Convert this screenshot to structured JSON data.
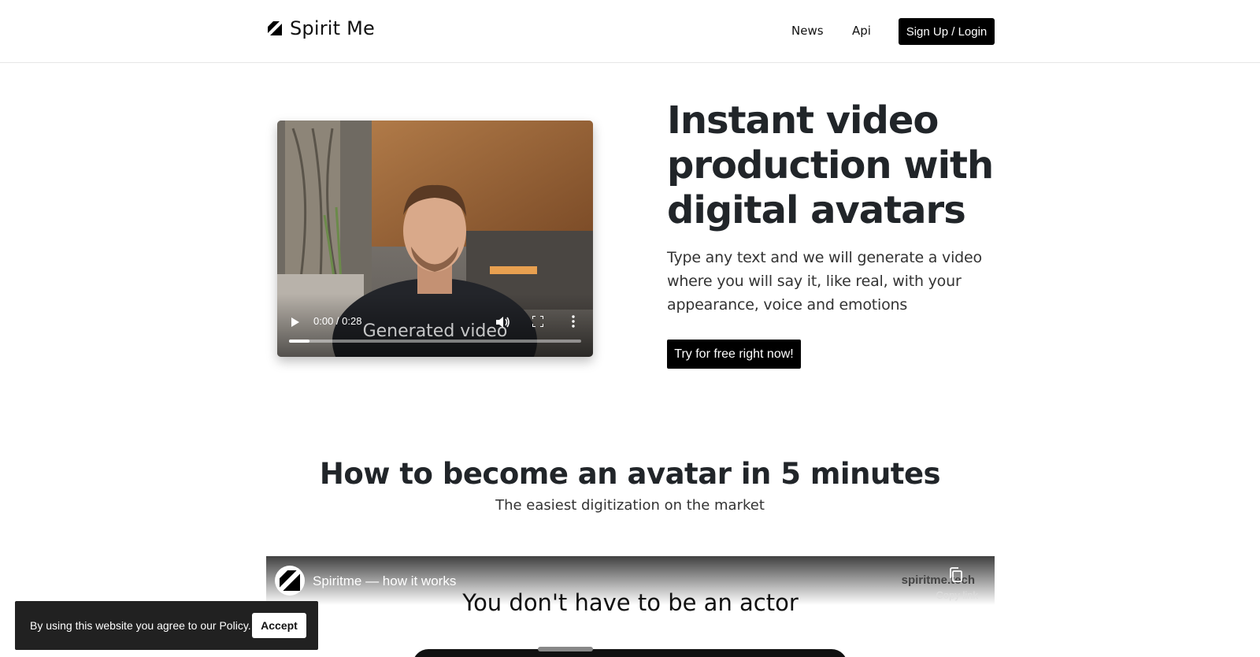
{
  "header": {
    "brand_name": "Spirit Me",
    "nav": {
      "news": "News",
      "api": "Api"
    },
    "login_label": "Sign Up / Login"
  },
  "hero": {
    "title": "Instant video production with digital avatars",
    "subtitle": "Type any text and we will generate a video where you will say it, like real, with your appearance, voice and emotions",
    "cta_label": "Try for free right now!",
    "video": {
      "time": "0:00 / 0:28",
      "caption": "Generated video",
      "progress_fraction": 0.07
    }
  },
  "section_avatar": {
    "title": "How to become an avatar in 5 minutes",
    "subtitle": "The easiest digitization on the market"
  },
  "embed": {
    "title": "Spiritme — how it works",
    "domain": "spiritme.tech",
    "copy_label": "Copy link",
    "headline": "You don't have to be an actor"
  },
  "cookie": {
    "text": "By using this website you agree to our Policy.",
    "accept_label": "Accept"
  },
  "colors": {
    "button_bg": "#000000",
    "text_dark": "#212529",
    "cookie_bg": "#212121"
  }
}
